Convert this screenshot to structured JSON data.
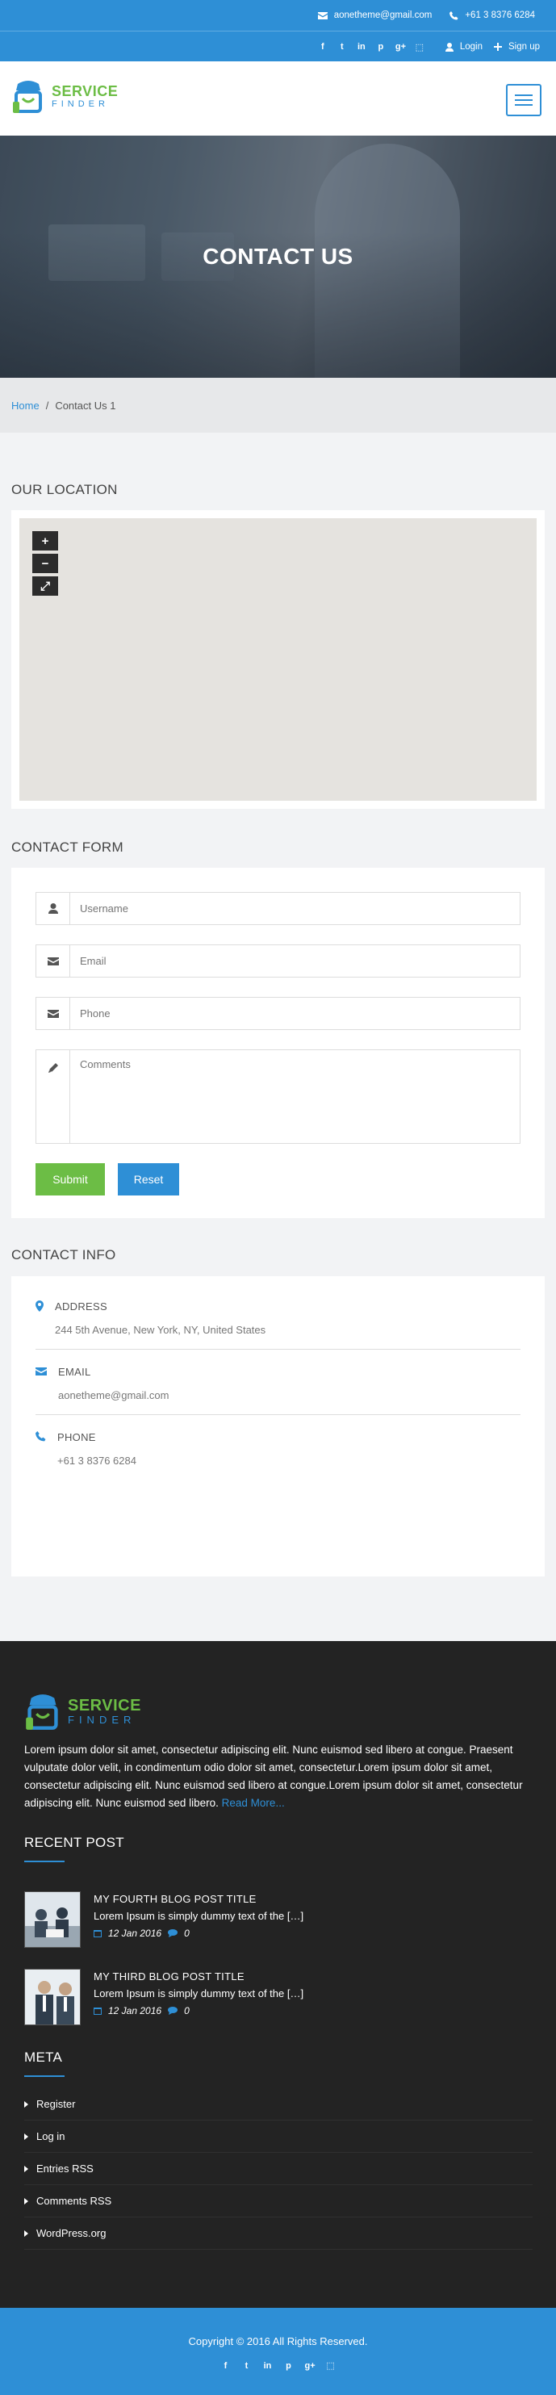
{
  "topbar": {
    "email": "aonetheme@gmail.com",
    "phone": "+61 3 8376 6284",
    "social": [
      "f",
      "t",
      "in",
      "p",
      "g+",
      "⬚"
    ],
    "login": "Login",
    "signup": "Sign up"
  },
  "logo": {
    "line1": "SERVICE",
    "line2": "FINDER"
  },
  "hero": {
    "title": "CONTACT US"
  },
  "breadcrumb": {
    "home": "Home",
    "separator": "/",
    "current": "Contact Us 1"
  },
  "location": {
    "title": "OUR LOCATION",
    "zoom_in": "+",
    "zoom_out": "−",
    "fullscreen": "⤢"
  },
  "contact_form": {
    "title": "CONTACT FORM",
    "username_placeholder": "Username",
    "email_placeholder": "Email",
    "phone_placeholder": "Phone",
    "comments_placeholder": "Comments",
    "submit": "Submit",
    "reset": "Reset"
  },
  "contact_info": {
    "title": "CONTACT INFO",
    "items": [
      {
        "label": "ADDRESS",
        "value": "244 5th Avenue, New York, NY, United States"
      },
      {
        "label": "EMAIL",
        "value": "aonetheme@gmail.com"
      },
      {
        "label": "PHONE",
        "value": "+61 3 8376 6284"
      }
    ]
  },
  "footer": {
    "about": "Lorem ipsum dolor sit amet, consectetur adipiscing elit. Nunc euismod sed libero at congue. Praesent vulputate dolor velit, in condimentum odio dolor sit amet, consectetur.Lorem ipsum dolor sit amet, consectetur adipiscing elit. Nunc euismod sed libero at congue.Lorem ipsum dolor sit amet, consectetur adipiscing elit. Nunc euismod sed libero.",
    "read_more": "Read More...",
    "recent_post_title": "RECENT POST",
    "posts": [
      {
        "title": "MY FOURTH BLOG POST TITLE",
        "excerpt": "Lorem Ipsum is simply dummy text of the […]",
        "date": "12 Jan 2016",
        "comments": "0"
      },
      {
        "title": "MY THIRD BLOG POST TITLE",
        "excerpt": "Lorem Ipsum is simply dummy text of the […]",
        "date": "12 Jan 2016",
        "comments": "0"
      }
    ],
    "meta_title": "META",
    "meta": [
      "Register",
      "Log in",
      "Entries RSS",
      "Comments RSS",
      "WordPress.org"
    ],
    "copyright": "Copyright © 2016 All Rights Reserved."
  },
  "colors": {
    "primary": "#2e8fd6",
    "accent": "#6cbd45",
    "footer_bg": "#232323"
  }
}
